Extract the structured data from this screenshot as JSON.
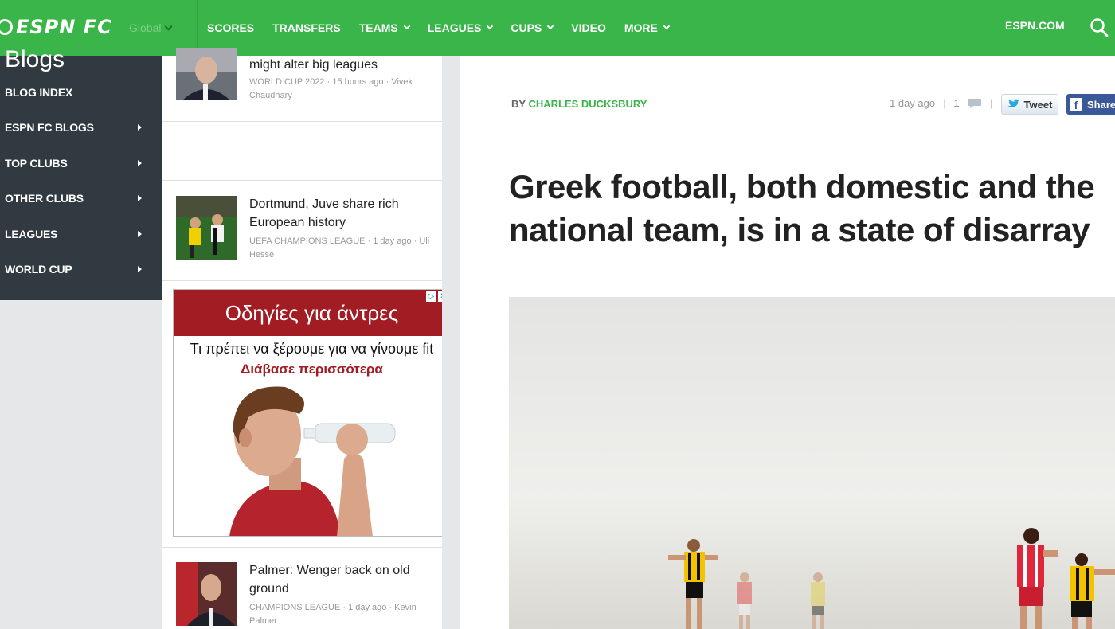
{
  "header": {
    "brand": "ESPN FC",
    "edition": "Global",
    "nav": [
      "SCORES",
      "TRANSFERS",
      "TEAMS",
      "LEAGUES",
      "CUPS",
      "VIDEO",
      "MORE"
    ],
    "espn_link": "ESPN.COM",
    "color_bg": "#3ab54a"
  },
  "sidebar": {
    "title": "Blogs",
    "items": [
      {
        "label": "BLOG INDEX"
      },
      {
        "label": "ESPN FC BLOGS"
      },
      {
        "label": "TOP CLUBS"
      },
      {
        "label": "OTHER CLUBS"
      },
      {
        "label": "LEAGUES"
      },
      {
        "label": "WORLD CUP"
      }
    ]
  },
  "feed": {
    "items": [
      {
        "title": "might alter big leagues",
        "meta": "WORLD CUP 2022 · 15 hours ago · Vivek Chaudhary"
      },
      {
        "title": "Dortmund, Juve share rich European history",
        "meta": "UEFA CHAMPIONS LEAGUE · 1 day ago · Uli Hesse"
      },
      {
        "title": "Palmer: Wenger back on old ground",
        "meta": "CHAMPIONS LEAGUE · 1 day ago · Kevin Palmer"
      }
    ]
  },
  "ad": {
    "heading": "Οδηγίες για άντρες",
    "line1": "Τι πρέπει να ξέρουμε για να γίνουμε fit",
    "line2": "Διάβασε περισσότερα",
    "color": "#a11c23"
  },
  "article": {
    "by_prefix": "BY",
    "author": "CHARLES DUCKSBURY",
    "time": "1 day ago",
    "comments": "1",
    "tweet_label": "Tweet",
    "share_label": "Share",
    "headline": "Greek football, both domestic and the national team, is in a state of disarray"
  }
}
